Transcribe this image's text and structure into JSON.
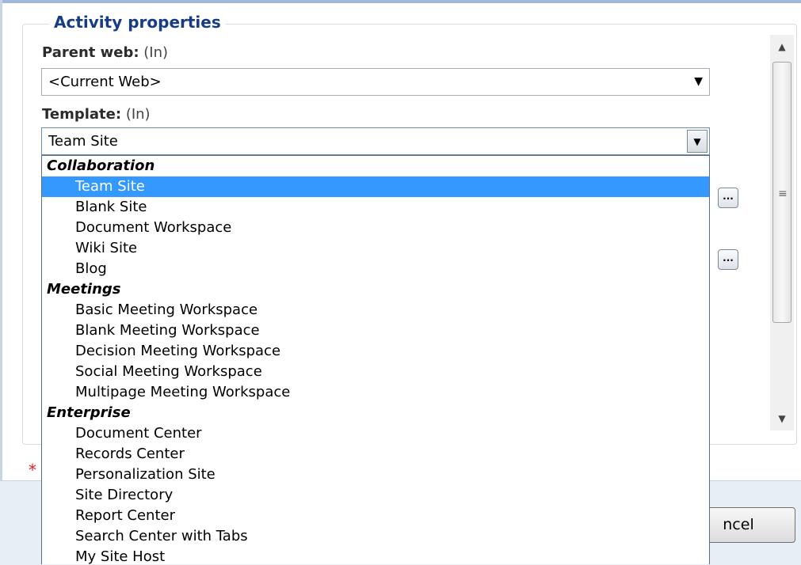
{
  "section": {
    "legend": "Activity properties"
  },
  "parent_web": {
    "label": "Parent web:",
    "direction": "(In)",
    "value": "<Current Web>"
  },
  "template": {
    "label": "Template:",
    "direction": "(In)",
    "value": "Team Site"
  },
  "dropdown": {
    "groups": [
      {
        "name": "Collaboration",
        "items": [
          "Team Site",
          "Blank Site",
          "Document Workspace",
          "Wiki Site",
          "Blog"
        ]
      },
      {
        "name": "Meetings",
        "items": [
          "Basic Meeting Workspace",
          "Blank Meeting Workspace",
          "Decision Meeting Workspace",
          "Social Meeting Workspace",
          "Multipage Meeting Workspace"
        ]
      },
      {
        "name": "Enterprise",
        "items": [
          "Document Center",
          "Records Center",
          "Personalization Site",
          "Site Directory",
          "Report Center",
          "Search Center with Tabs",
          "My Site Host"
        ]
      }
    ],
    "selected": "Team Site"
  },
  "buttons": {
    "ellipsis": "...",
    "cancel": "ncel"
  },
  "required_marker": "*",
  "colors": {
    "legend": "#153c84",
    "selection": "#3399ff",
    "required": "#e02020"
  }
}
